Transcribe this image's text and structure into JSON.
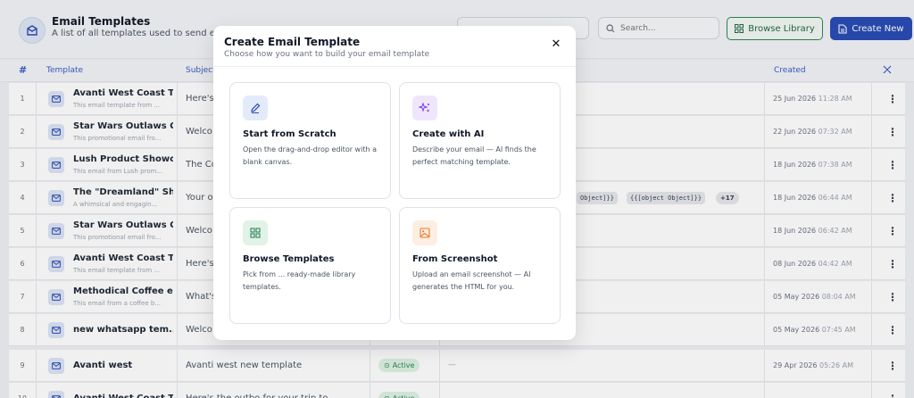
{
  "header": {
    "title": "Email Templates",
    "subtitle": "A list of all templates used to send emails t",
    "search_placeholder": "Search...",
    "browse_label": "Browse Library",
    "create_label": "Create New"
  },
  "table": {
    "columns": {
      "num": "#",
      "template": "Template",
      "subject": "Subject",
      "created": "Created"
    },
    "rows": [
      {
        "num": "1",
        "name": "Avanti West Coast T...",
        "desc": "This email template from ...",
        "subject": "Here's",
        "created_date": "25 Jun 2026",
        "created_time": "11:28 AM"
      },
      {
        "num": "2",
        "name": "Star Wars Outlaws G...",
        "desc": "This promotional email fro...",
        "subject": "Welco",
        "created_date": "22 Jun 2026",
        "created_time": "07:32 AM"
      },
      {
        "num": "3",
        "name": "Lush Product Showc...",
        "desc": "This email from Lush prom...",
        "subject": "The Co",
        "created_date": "18 Jun 2026",
        "created_time": "07:38 AM"
      },
      {
        "num": "4",
        "name": "The \"Dreamland\" Shi...",
        "desc": "A whimsical and engagin...",
        "subject": "Your o",
        "created_date": "18 Jun 2026",
        "created_time": "06:44 AM",
        "chip1": "Object]}}",
        "chip2": "{{[object Object]}}",
        "more": "+17"
      },
      {
        "num": "5",
        "name": "Star Wars Outlaws G...",
        "desc": "This promotional email fro...",
        "subject": "Welco",
        "created_date": "18 Jun 2026",
        "created_time": "06:42 AM"
      },
      {
        "num": "6",
        "name": "Avanti West Coast T...",
        "desc": "This email template from ...",
        "subject": "Here's",
        "created_date": "08 Jun 2026",
        "created_time": "04:42 AM"
      },
      {
        "num": "7",
        "name": "Methodical Coffee e...",
        "desc": "This email from a coffee b...",
        "subject": "What's",
        "created_date": "05 May 2026",
        "created_time": "08:04 AM"
      },
      {
        "num": "8",
        "name": "new whatsapp tem...",
        "subject": "Welco",
        "created_date": "05 May 2026",
        "created_time": "07:45 AM"
      },
      {
        "num": "9",
        "name": "Avanti west",
        "subject": "Avanti west new template",
        "status": "Active",
        "vars": "—",
        "created_date": "29 Apr 2026",
        "created_time": "05:26 AM"
      },
      {
        "num": "10",
        "name": "Avanti West Coast T...",
        "subject": "Here's the outbo  for your trip to",
        "status": "Active"
      }
    ]
  },
  "modal": {
    "title": "Create Email Template",
    "subtitle": "Choose how you want to build your email template",
    "cards": [
      {
        "title": "Start from Scratch",
        "desc": "Open the drag-and-drop editor with a blank canvas."
      },
      {
        "title": "Create with AI",
        "desc": "Describe your email — AI finds the perfect matching template."
      },
      {
        "title": "Browse Templates",
        "desc": "Pick from ... ready-made library templates."
      },
      {
        "title": "From Screenshot",
        "desc": "Upload an email screenshot — AI generates the HTML for you."
      }
    ]
  },
  "colors": {
    "primary": "#2a4db5",
    "library_green": "#2f855a",
    "ai_purple": "#7c3aed",
    "screenshot_orange": "#ea7a2f"
  }
}
